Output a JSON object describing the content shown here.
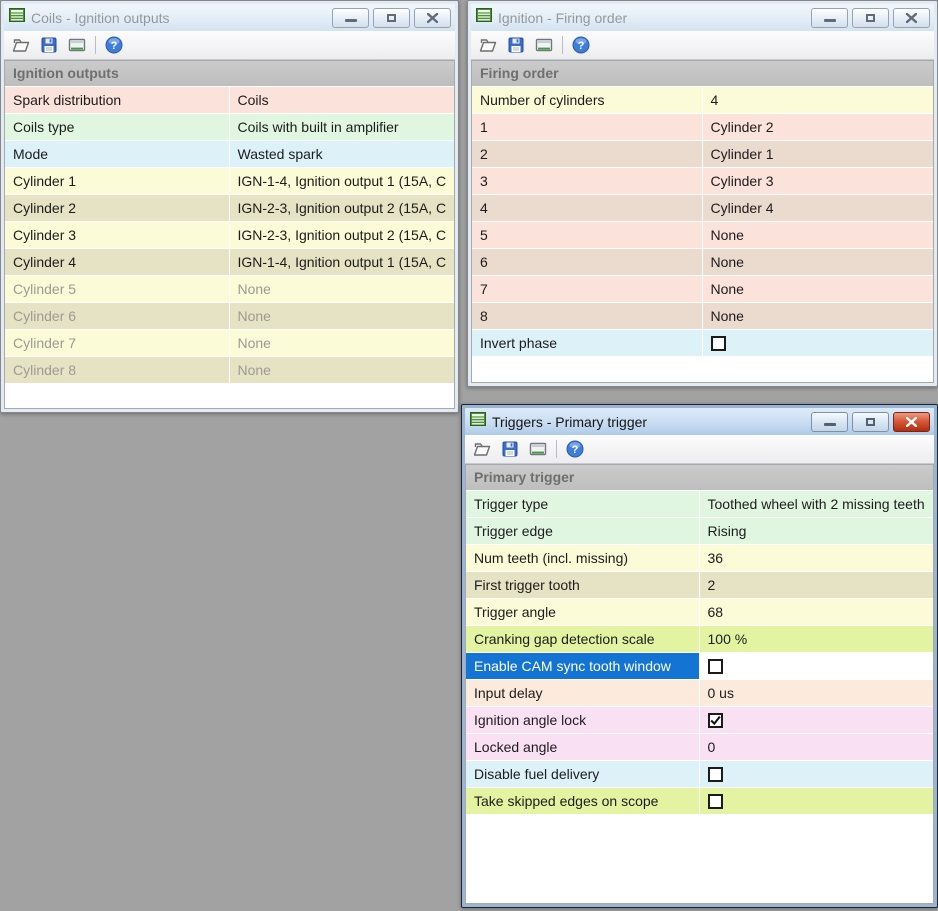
{
  "palette": {
    "desktop": "#A2A2A2",
    "selection_blue": "#1474D4",
    "row_pink": "#FBE3DB",
    "row_green": "#E1F6E0",
    "row_blue": "#DDF1F8",
    "row_yellow": "#FCFBD8",
    "row_khaki": "#E6E3C4",
    "row_tan": "#EBDACE",
    "row_lime": "#E4F3A2",
    "row_peach": "#FCEADC",
    "row_magenta": "#FAE0F3",
    "disabled_text": "#9B9B93",
    "active_close_red": "#B12D10"
  },
  "windows": [
    {
      "id": "coils",
      "cls": "win-coils",
      "title": "Coils - Ignition outputs",
      "header": "Ignition outputs",
      "active": false,
      "rows": [
        {
          "label": "Spark distribution",
          "value": "Coils",
          "color": "pink"
        },
        {
          "label": "Coils type",
          "value": "Coils with built in amplifier",
          "color": "green"
        },
        {
          "label": "Mode",
          "value": "Wasted spark",
          "color": "blue"
        },
        {
          "label": "Cylinder 1",
          "value": "IGN-1-4, Ignition output 1 (15A, C",
          "color": "yellow"
        },
        {
          "label": "Cylinder 2",
          "value": "IGN-2-3, Ignition output 2 (15A, C",
          "color": "khaki"
        },
        {
          "label": "Cylinder 3",
          "value": "IGN-2-3, Ignition output 2 (15A, C",
          "color": "yellow"
        },
        {
          "label": "Cylinder 4",
          "value": "IGN-1-4, Ignition output 1 (15A, C",
          "color": "khaki"
        },
        {
          "label": "Cylinder 5",
          "value": "None",
          "color": "yellow",
          "disabled": true
        },
        {
          "label": "Cylinder 6",
          "value": "None",
          "color": "khaki",
          "disabled": true
        },
        {
          "label": "Cylinder 7",
          "value": "None",
          "color": "yellow",
          "disabled": true
        },
        {
          "label": "Cylinder 8",
          "value": "None",
          "color": "khaki",
          "disabled": true
        }
      ]
    },
    {
      "id": "firing",
      "cls": "win-firing",
      "title": "Ignition - Firing order",
      "header": "Firing order",
      "active": false,
      "rows": [
        {
          "label": "Number of cylinders",
          "value": "4",
          "color": "yellow"
        },
        {
          "label": "1",
          "value": "Cylinder 2",
          "color": "pink"
        },
        {
          "label": "2",
          "value": "Cylinder 1",
          "color": "tan"
        },
        {
          "label": "3",
          "value": "Cylinder 3",
          "color": "pink"
        },
        {
          "label": "4",
          "value": "Cylinder 4",
          "color": "tan"
        },
        {
          "label": "5",
          "value": "None",
          "color": "pink"
        },
        {
          "label": "6",
          "value": "None",
          "color": "tan"
        },
        {
          "label": "7",
          "value": "None",
          "color": "pink"
        },
        {
          "label": "8",
          "value": "None",
          "color": "tan"
        },
        {
          "label": "Invert phase",
          "checkbox": true,
          "checked": false,
          "color": "blue"
        }
      ]
    },
    {
      "id": "triggers",
      "cls": "win-triggers",
      "title": "Triggers - Primary trigger",
      "header": "Primary trigger",
      "active": true,
      "rows": [
        {
          "label": "Trigger type",
          "value": "Toothed wheel with 2 missing teeth",
          "color": "green"
        },
        {
          "label": "Trigger edge",
          "value": "Rising",
          "color": "green"
        },
        {
          "label": "Num teeth (incl. missing)",
          "value": "36",
          "color": "yellow"
        },
        {
          "label": "First trigger tooth",
          "value": "2",
          "color": "khaki"
        },
        {
          "label": "Trigger angle",
          "value": "68",
          "color": "yellow"
        },
        {
          "label": "Cranking gap detection scale",
          "value": "100 %",
          "color": "lime"
        },
        {
          "label": "Enable CAM sync tooth window",
          "checkbox": true,
          "checked": false,
          "color": "plain",
          "selected": true
        },
        {
          "label": "Input delay",
          "value": "0 us",
          "color": "peach"
        },
        {
          "label": "Ignition angle lock",
          "checkbox": true,
          "checked": true,
          "color": "magenta"
        },
        {
          "label": "Locked angle",
          "value": "0",
          "color": "magenta"
        },
        {
          "label": "Disable fuel delivery",
          "checkbox": true,
          "checked": false,
          "color": "blue"
        },
        {
          "label": "Take skipped edges on scope",
          "checkbox": true,
          "checked": false,
          "color": "lime"
        }
      ]
    }
  ]
}
